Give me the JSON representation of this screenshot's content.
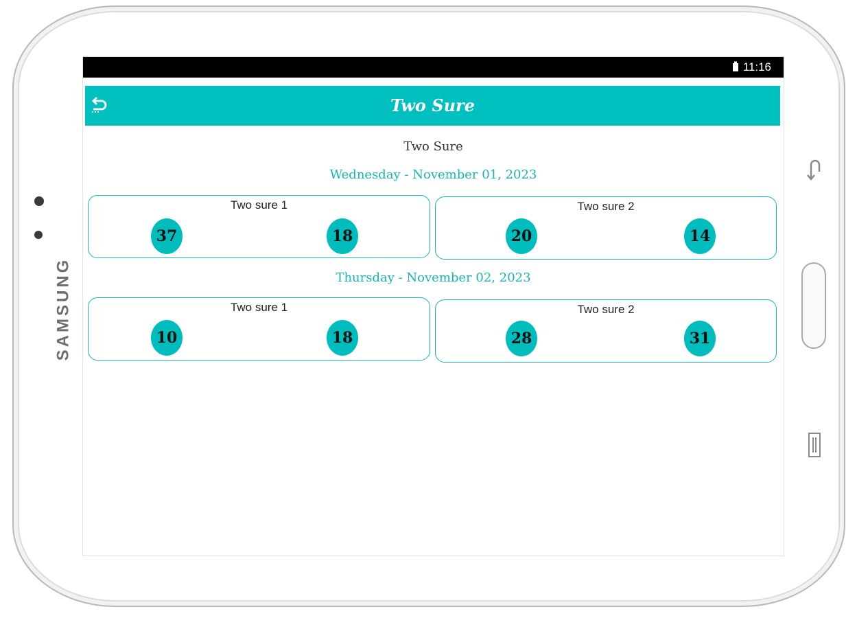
{
  "device": {
    "brand": "SAMSUNG",
    "icons": {
      "back_key": "back-key-icon",
      "menu_key": "menu-key-icon",
      "battery": "battery-icon",
      "app_back": "back-arrow-icon"
    }
  },
  "status_bar": {
    "time": "11:16"
  },
  "app_bar": {
    "title": "Two Sure"
  },
  "page": {
    "heading": "Two Sure",
    "days": [
      {
        "date": "Wednesday - November 01, 2023",
        "cards": [
          {
            "title": "Two sure 1",
            "numbers": [
              "37",
              "18"
            ]
          },
          {
            "title": "Two sure 2",
            "numbers": [
              "20",
              "14"
            ]
          }
        ]
      },
      {
        "date": "Thursday - November 02, 2023",
        "cards": [
          {
            "title": "Two sure 1",
            "numbers": [
              "10",
              "18"
            ]
          },
          {
            "title": "Two sure 2",
            "numbers": [
              "28",
              "31"
            ]
          }
        ]
      }
    ]
  },
  "colors": {
    "accent": "#00bfbf",
    "date_text": "#16b5b5",
    "status_bar": "#000000"
  }
}
